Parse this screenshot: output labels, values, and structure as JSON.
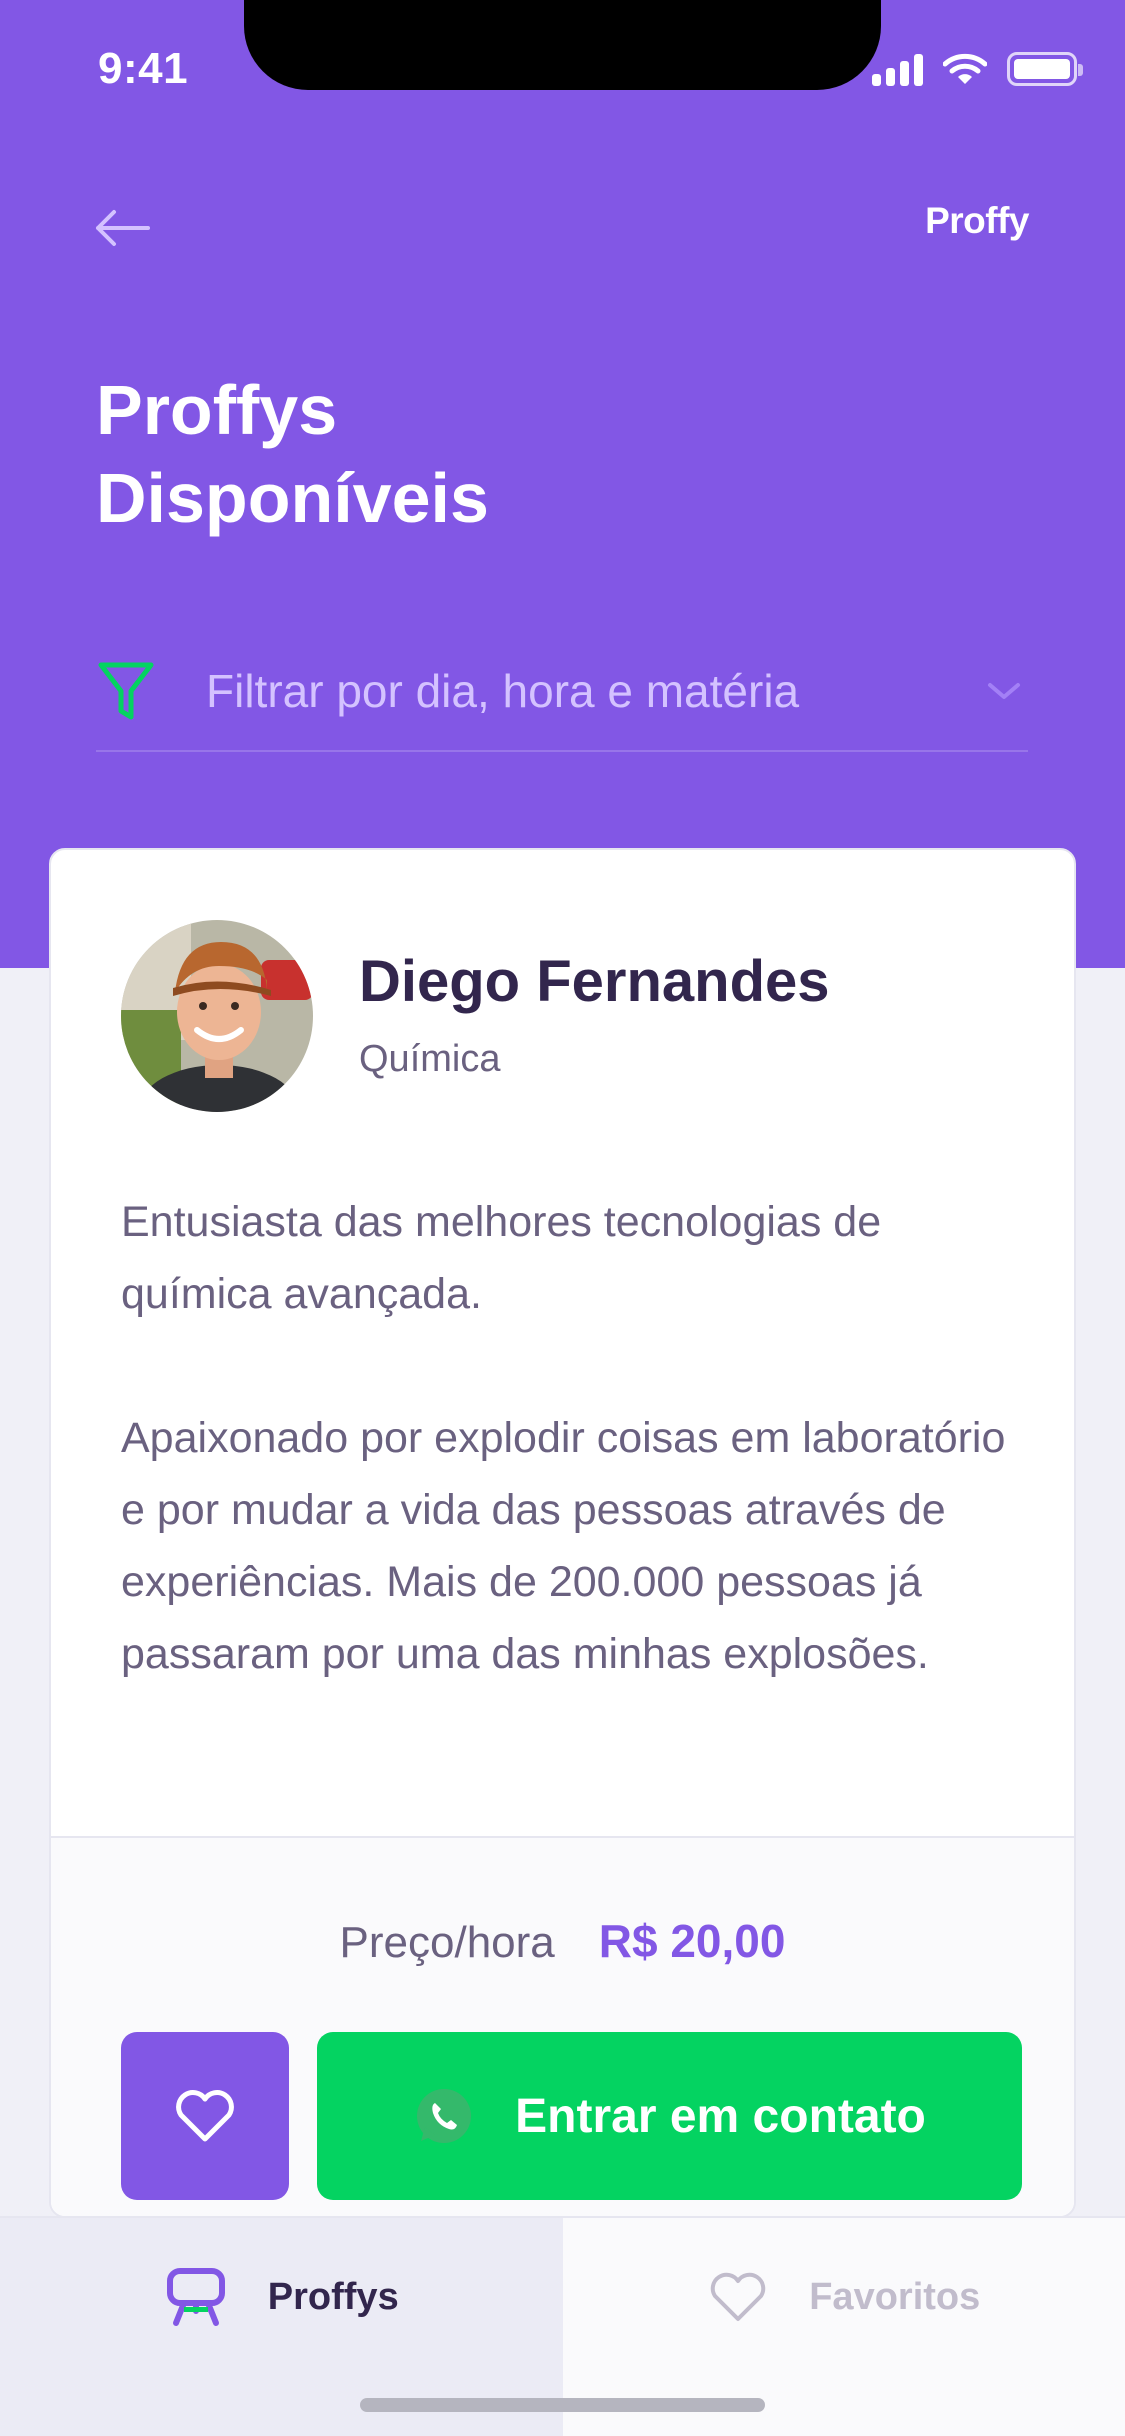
{
  "status_bar": {
    "time": "9:41"
  },
  "header": {
    "logo": "Proffy",
    "title_line1": "Proffys",
    "title_line2": "Disponíveis",
    "filter_label": "Filtrar por dia, hora e matéria"
  },
  "card": {
    "name": "Diego Fernandes",
    "subject": "Química",
    "bio_p1": "Entusiasta das melhores tecnologias de química avançada.",
    "bio_p2": "Apaixonado por explodir coisas em laboratório e por mudar a vida das pessoas através de experiências. Mais de 200.000 pessoas já passaram por uma das minhas explosões.",
    "price_label": "Preço/hora",
    "price_value": "R$ 20,00",
    "contact_label": "Entrar em contato"
  },
  "tabbar": {
    "tabs": [
      {
        "label": "Proffys",
        "active": true
      },
      {
        "label": "Favoritos",
        "active": false
      }
    ]
  },
  "colors": {
    "primary": "#8257E5",
    "green": "#04D361",
    "title_dark": "#32264D",
    "text": "#6A6180"
  }
}
